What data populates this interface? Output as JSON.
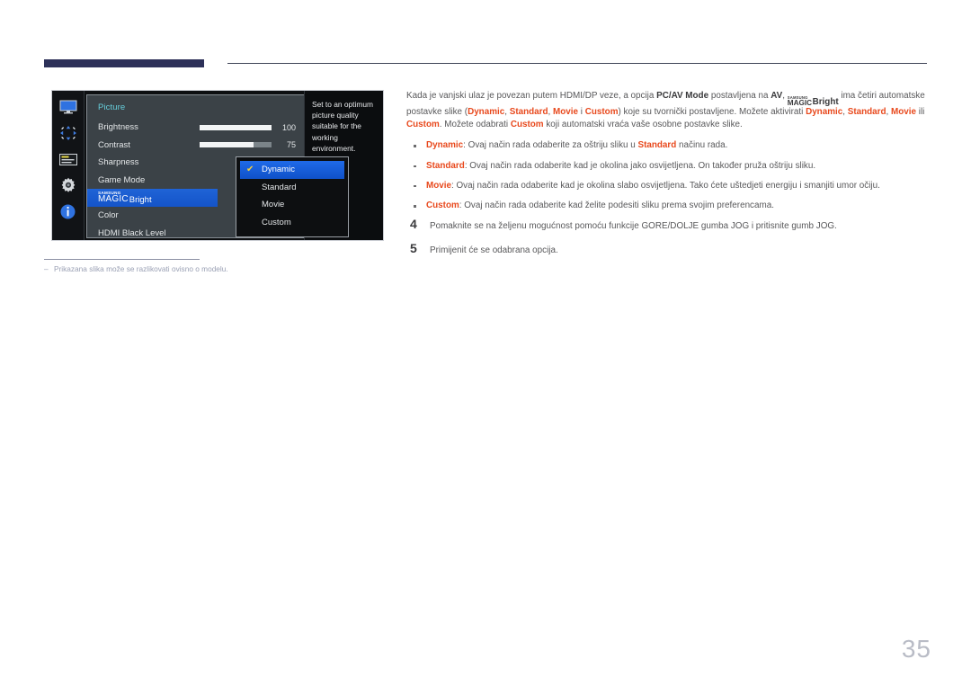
{
  "page": {
    "number": "35",
    "footnote_dash": "–",
    "footnote": "Prikazana slika može se razlikovati ovisno o modelu."
  },
  "osd": {
    "rail_icons": [
      {
        "name": "monitor-icon"
      },
      {
        "name": "arrows-adjust-icon"
      },
      {
        "name": "onscreen-display-icon"
      },
      {
        "name": "gear-settings-icon"
      },
      {
        "name": "information-icon"
      }
    ],
    "menu_title": "Picture",
    "items": [
      {
        "label": "Brightness",
        "type": "slider",
        "value": "100",
        "fill_percent": 100,
        "selected": false
      },
      {
        "label": "Contrast",
        "type": "slider",
        "value": "75",
        "fill_percent": 75,
        "selected": false
      },
      {
        "label": "Sharpness",
        "type": "plain",
        "selected": false
      },
      {
        "label": "Game Mode",
        "type": "plain",
        "selected": false
      },
      {
        "label": "MAGICBright",
        "type": "magic",
        "brand": "SAMSUNG",
        "magic": "MAGIC",
        "suffix": "Bright",
        "selected": true
      },
      {
        "label": "Color",
        "type": "plain",
        "selected": false
      },
      {
        "label": "HDMI Black Level",
        "type": "plain",
        "selected": false
      }
    ],
    "dropdown": {
      "check_glyph": "✔",
      "options": [
        {
          "label": "Dynamic",
          "selected": true
        },
        {
          "label": "Standard",
          "selected": false
        },
        {
          "label": "Movie",
          "selected": false
        },
        {
          "label": "Custom",
          "selected": false
        }
      ]
    },
    "help_text": "Set to an optimum picture quality suitable for the working environment."
  },
  "content": {
    "intro_segments": [
      {
        "t": "Kada je vanjski ulaz je povezan putem HDMI/DP veze, a opcija ",
        "s": "n"
      },
      {
        "t": "PC/AV Mode",
        "s": "k"
      },
      {
        "t": " postavljena na ",
        "s": "n"
      },
      {
        "t": "AV",
        "s": "k"
      },
      {
        "t": ", ",
        "s": "n"
      },
      {
        "t": "MAGICBRIGHT_LOGO",
        "s": "logo"
      },
      {
        "t": " ima četiri automatske postavke slike (",
        "s": "n"
      },
      {
        "t": "Dynamic",
        "s": "o"
      },
      {
        "t": ", ",
        "s": "n"
      },
      {
        "t": "Standard",
        "s": "o"
      },
      {
        "t": ", ",
        "s": "n"
      },
      {
        "t": "Movie",
        "s": "o"
      },
      {
        "t": " i ",
        "s": "n"
      },
      {
        "t": "Custom",
        "s": "o"
      },
      {
        "t": ") koje su tvornički postavljene. Možete aktivirati ",
        "s": "n"
      },
      {
        "t": "Dynamic",
        "s": "o"
      },
      {
        "t": ", ",
        "s": "n"
      },
      {
        "t": "Standard",
        "s": "o"
      },
      {
        "t": ", ",
        "s": "n"
      },
      {
        "t": "Movie",
        "s": "o"
      },
      {
        "t": " ili ",
        "s": "n"
      },
      {
        "t": "Custom",
        "s": "o"
      },
      {
        "t": ". Možete odabrati ",
        "s": "n"
      },
      {
        "t": "Custom",
        "s": "o"
      },
      {
        "t": " koji automatski vraća vaše osobne postavke slike.",
        "s": "n"
      }
    ],
    "bullets": [
      {
        "segments": [
          {
            "t": "Dynamic",
            "s": "o"
          },
          {
            "t": ": Ovaj način rada odaberite za oštriju sliku u ",
            "s": "n"
          },
          {
            "t": "Standard",
            "s": "o"
          },
          {
            "t": " načinu rada.",
            "s": "n"
          }
        ]
      },
      {
        "segments": [
          {
            "t": "Standard",
            "s": "o"
          },
          {
            "t": ": Ovaj način rada odaberite kad je okolina jako osvijetljena. On također pruža oštriju sliku.",
            "s": "n"
          }
        ]
      },
      {
        "segments": [
          {
            "t": "Movie",
            "s": "o"
          },
          {
            "t": ": Ovaj način rada odaberite kad je okolina slabo osvijetljena. Tako ćete uštedjeti energiju i smanjiti umor očiju.",
            "s": "n"
          }
        ]
      },
      {
        "segments": [
          {
            "t": "Custom",
            "s": "o"
          },
          {
            "t": ": Ovaj način rada odaberite kad želite podesiti sliku prema svojim preferencama.",
            "s": "n"
          }
        ]
      }
    ],
    "steps": [
      {
        "num": "4",
        "text": "Pomaknite se na željenu mogućnost pomoću funkcije GORE/DOLJE gumba JOG i pritisnite gumb JOG."
      },
      {
        "num": "5",
        "text": "Primijenit će se odabrana opcija."
      }
    ]
  }
}
